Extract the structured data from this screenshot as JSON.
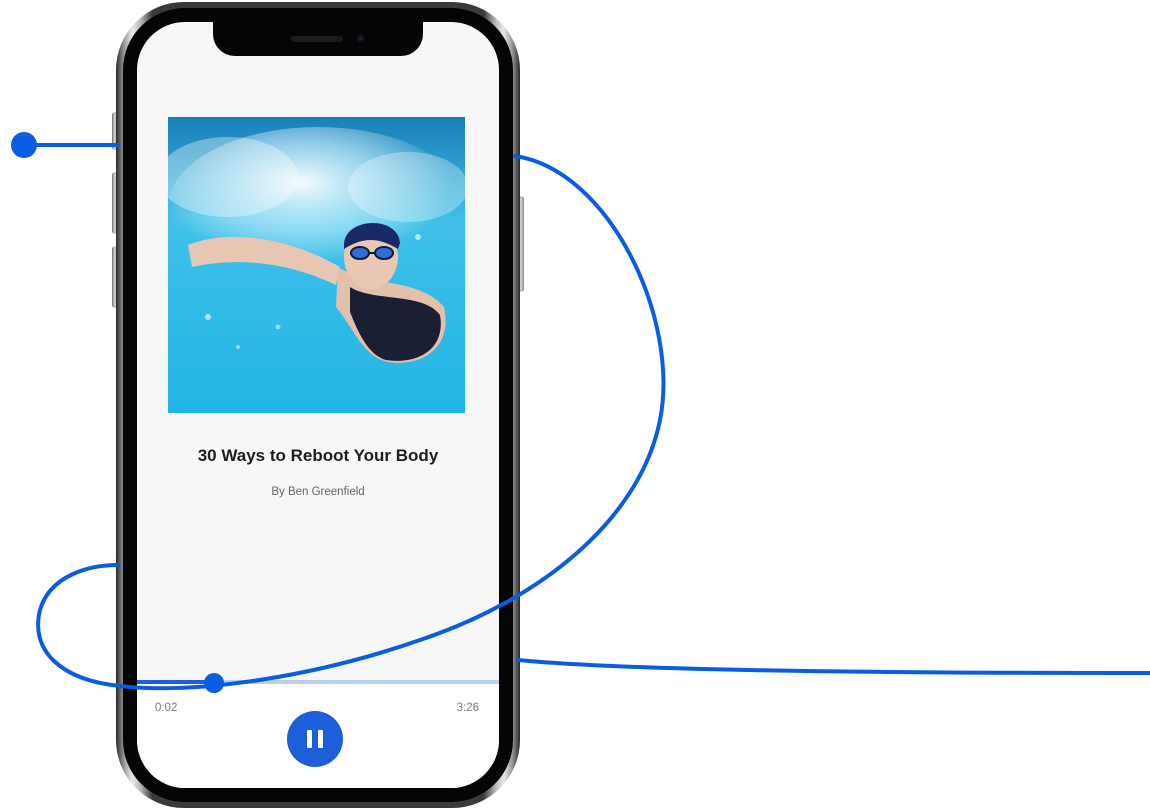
{
  "colors": {
    "accent": "#1d5fd8",
    "progress_track": "#b9d0f3",
    "screen_bg": "#f7f7f7",
    "decor_line": "#0a5ce0"
  },
  "player": {
    "cover_alt": "Swimmer underwater in a pool",
    "title": "30 Ways to Reboot Your Body",
    "author": "By Ben Greenfield",
    "time_current": "0:02",
    "time_total": "3:26",
    "progress_fraction": 0.23,
    "pause_icon": "pause-icon"
  }
}
